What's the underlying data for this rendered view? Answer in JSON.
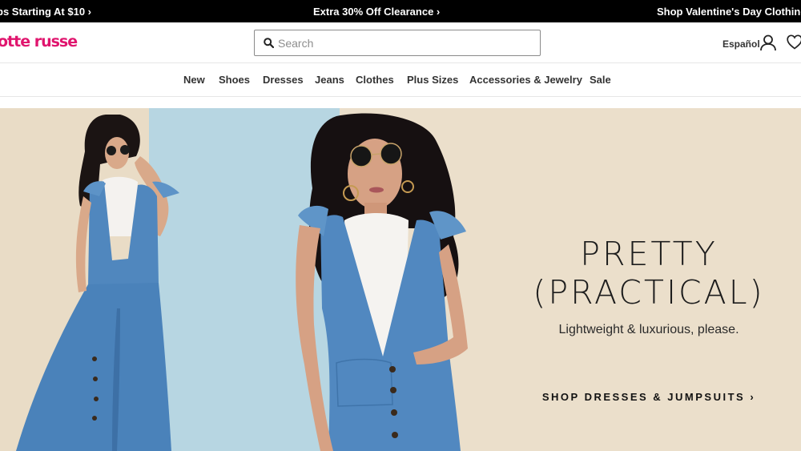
{
  "promo_bar": {
    "items": [
      "ps Starting At $10 ›",
      "Extra 30% Off Clearance ›",
      "Shop Valentine's Day Clothing &"
    ]
  },
  "header": {
    "logo": "otte russe",
    "search": {
      "placeholder": "Search",
      "value": ""
    },
    "language": "Español",
    "icons": [
      "search-icon",
      "user-icon",
      "heart-icon"
    ]
  },
  "nav": {
    "items": [
      "New",
      "Shoes",
      "Dresses",
      "Jeans",
      "Clothes",
      "Plus Sizes",
      "Accessories & Jewelry",
      "Sale"
    ]
  },
  "hero": {
    "title_line1": "PRETTY",
    "title_line2": "(PRACTICAL)",
    "subtitle": "Lightweight & luxurious, please.",
    "cta": "SHOP DRESSES & JUMPSUITS ›"
  },
  "colors": {
    "brand": "#e0156e",
    "promo_bg": "#000000",
    "hero_beige": "#ebdfcb",
    "hero_blue": "#b7d6e2",
    "denim": "#4f86be"
  }
}
